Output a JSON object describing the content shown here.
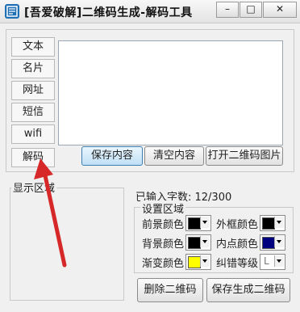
{
  "window": {
    "title": "[吾爱破解]二维码生成-解码工具",
    "minimize": "–",
    "maximize": "□",
    "close": "✕"
  },
  "modes": [
    "文本",
    "名片",
    "网址",
    "短信",
    "wifi",
    "解码"
  ],
  "buttons": {
    "save_content": "保存内容",
    "clear_content": "清空内容",
    "open_image": "打开二维码图片",
    "delete_qr": "删除二维码",
    "save_generate": "保存生成二维码"
  },
  "preview": {
    "legend": "显示区域"
  },
  "status": {
    "char_count": "已输入字数: 12/300"
  },
  "settings": {
    "legend": "设置区域",
    "foreground_color": "前景颜色",
    "background_color": "背景颜色",
    "gradient_color": "渐变颜色",
    "border_color": "外框颜色",
    "inner_dot_color": "内点颜色",
    "ec_level_label": "纠错等级",
    "ec_level_value": "L"
  },
  "colors": {
    "foreground": "#000000",
    "background": "#000000",
    "gradient": "#ffff00",
    "border": "#000000",
    "inner_dot": "#00007f",
    "arrow": "#d62828"
  }
}
